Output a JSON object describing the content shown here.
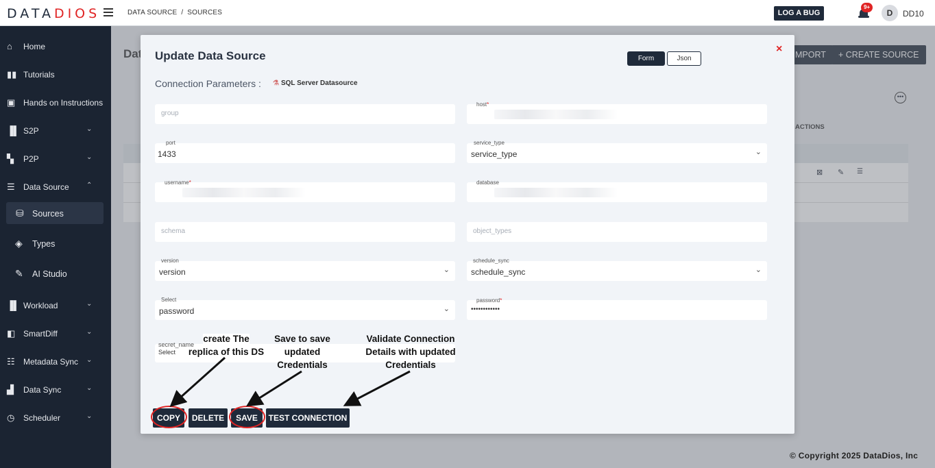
{
  "app": {
    "logo_prefix": "DATA",
    "logo_accent": "DIOS",
    "breadcrumb": "DATA SOURCE  /  SOURCES",
    "log_bug_label": "LOG A BUG",
    "notification_count": "9+",
    "avatar_initial": "D",
    "user_name": "DD10",
    "accent_color": "#e02424",
    "nav_color": "#1b2432"
  },
  "sidebar": {
    "items": [
      {
        "label": "Home",
        "icon": "home-icon"
      },
      {
        "label": "Tutorials",
        "icon": "book-icon"
      },
      {
        "label": "Hands on Instructions",
        "icon": "briefcase-icon"
      },
      {
        "label": "S2P",
        "icon": "s2p-icon"
      },
      {
        "label": "P2P",
        "icon": "p2p-icon"
      },
      {
        "label": "Data Source",
        "icon": "list-icon"
      },
      {
        "label": "Sources",
        "icon": "database-icon"
      },
      {
        "label": "Types",
        "icon": "layers-icon"
      },
      {
        "label": "AI Studio",
        "icon": "edit-icon"
      },
      {
        "label": "Workload",
        "icon": "workload-icon"
      },
      {
        "label": "SmartDiff",
        "icon": "diff-icon"
      },
      {
        "label": "Metadata Sync",
        "icon": "metadata-icon"
      },
      {
        "label": "Data Sync",
        "icon": "sync-icon"
      },
      {
        "label": "Scheduler",
        "icon": "clock-icon"
      }
    ]
  },
  "background": {
    "page_title": "Dat",
    "import_label": "MPORT",
    "create_label": "+ CREATE SOURCE",
    "actions_header": "ACTIONS"
  },
  "modal": {
    "title": "Update Data Source",
    "form_toggle": "Form",
    "json_toggle": "Json",
    "close": "×",
    "connection_label": "Connection Parameters :",
    "connection_type": "SQL Server Datasource",
    "fields": {
      "group": {
        "placeholder": "group"
      },
      "host": {
        "label": "host"
      },
      "port": {
        "label": "port",
        "value": "1433"
      },
      "service_type": {
        "label": "service_type",
        "value": "service_type"
      },
      "username": {
        "label": "username"
      },
      "database": {
        "label": "database"
      },
      "schema": {
        "placeholder": "schema"
      },
      "object_types": {
        "placeholder": "object_types"
      },
      "version": {
        "label": "version",
        "value": "version"
      },
      "schedule_sync": {
        "label": "schedule_sync",
        "value": "schedule_sync"
      },
      "select": {
        "label": "Select",
        "value": "password"
      },
      "password": {
        "label": "password",
        "value": "••••••••••••"
      },
      "secret_name": {
        "label": "secret_name",
        "value": "Select"
      }
    },
    "buttons": {
      "copy": "COPY",
      "delete": "DELETE",
      "save": "SAVE",
      "test": "TEST CONNECTION"
    }
  },
  "annotations": {
    "copy": "create The\nreplica of this DS",
    "save": "Save to save\nupdated\nCredentials",
    "test": "Validate Connection\nDetails with updated\nCredentials"
  },
  "footer": "© Copyright 2025 DataDios, Inc"
}
